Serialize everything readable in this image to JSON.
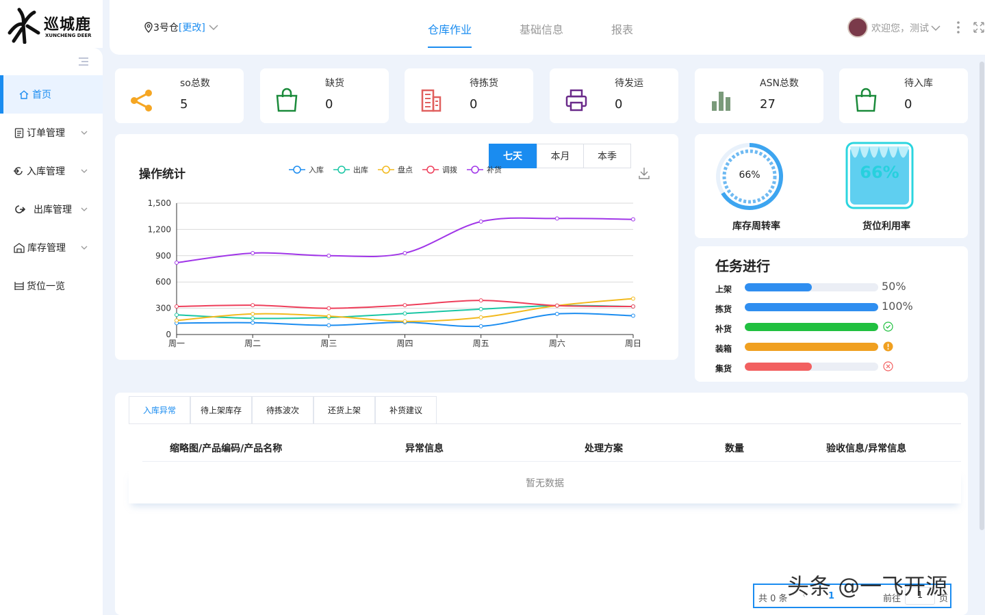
{
  "brand": {
    "name_cn": "巡城鹿",
    "name_en": "XUNCHENG DEER"
  },
  "header": {
    "warehouse": "3号仓",
    "change_label": "[更改]",
    "tabs": [
      "仓库作业",
      "基础信息",
      "报表"
    ],
    "active_tab": 0,
    "user_greeting": "欢迎您，测试"
  },
  "sidebar": {
    "items": [
      {
        "label": "首页",
        "icon": "home-icon",
        "active": true
      },
      {
        "label": "订单管理",
        "icon": "clipboard-icon"
      },
      {
        "label": "入库管理",
        "icon": "inbound-icon"
      },
      {
        "label": "出库管理",
        "icon": "outbound-icon"
      },
      {
        "label": "库存管理",
        "icon": "warehouse-icon"
      },
      {
        "label": "货位一览",
        "icon": "shelf-icon"
      }
    ]
  },
  "stats": [
    {
      "label": "so总数",
      "value": "5",
      "icon": "share-icon",
      "color": "#f5a623"
    },
    {
      "label": "缺货",
      "value": "0",
      "icon": "shopping-bag-icon",
      "color": "#1a8a3a"
    },
    {
      "label": "待拣货",
      "value": "0",
      "icon": "building-icon",
      "color": "#e0605f"
    },
    {
      "label": "待发运",
      "value": "0",
      "icon": "printer-icon",
      "color": "#6a2a8a"
    },
    {
      "label": "ASN总数",
      "value": "27",
      "icon": "bar-chart-icon",
      "color": "#7a9a7a"
    },
    {
      "label": "待入库",
      "value": "0",
      "icon": "shopping-bag-icon",
      "color": "#1a8a3a"
    }
  ],
  "op_chart": {
    "title": "操作统计",
    "ranges": [
      "七天",
      "本月",
      "本季"
    ],
    "active_range": 0
  },
  "chart_data": {
    "type": "line",
    "x": [
      "周一",
      "周二",
      "周三",
      "周四",
      "周五",
      "周六",
      "周日"
    ],
    "ylim": [
      0,
      1500
    ],
    "yticks": [
      "0",
      "300",
      "600",
      "900",
      "1,200",
      "1,500"
    ],
    "series": [
      {
        "name": "入库",
        "color": "#1a8cf0",
        "values": [
          130,
          135,
          105,
          140,
          95,
          235,
          215
        ]
      },
      {
        "name": "出库",
        "color": "#19c6a4",
        "values": [
          225,
          185,
          195,
          240,
          290,
          330,
          320
        ]
      },
      {
        "name": "盘点",
        "color": "#f2b91d",
        "values": [
          160,
          235,
          210,
          150,
          195,
          330,
          410
        ]
      },
      {
        "name": "调拨",
        "color": "#ee3e5a",
        "values": [
          320,
          335,
          300,
          335,
          390,
          330,
          320
        ]
      },
      {
        "name": "补货",
        "color": "#a035e8",
        "values": [
          820,
          930,
          900,
          930,
          1290,
          1325,
          1315
        ]
      }
    ],
    "grid": true,
    "legend": "top"
  },
  "gauges": [
    {
      "label": "库存周转率",
      "value": "66%"
    },
    {
      "label": "货位利用率",
      "value": "66%"
    }
  ],
  "tasks": {
    "title": "任务进行",
    "items": [
      {
        "label": "上架",
        "progress": 0.5,
        "text": "50%",
        "color": "#2f8ef0"
      },
      {
        "label": "拣货",
        "progress": 1.0,
        "text": "100%",
        "color": "#2f8ef0"
      },
      {
        "label": "补货",
        "progress": 1.0,
        "status_icon": "check-circle-icon",
        "color": "#20c040"
      },
      {
        "label": "装箱",
        "progress": 1.0,
        "status_icon": "warning-circle-icon",
        "color": "#f0a020"
      },
      {
        "label": "集货",
        "progress": 0.5,
        "status_icon": "close-circle-icon",
        "color": "#f26060"
      }
    ]
  },
  "bottom": {
    "tabs": [
      "入库异常",
      "待上架库存",
      "待拣波次",
      "还货上架",
      "补货建议"
    ],
    "active_tab": 0,
    "columns": [
      "缩略图/产品编码/产品名称",
      "异常信息",
      "处理方案",
      "数量",
      "验收信息/异常信息"
    ],
    "empty_text": "暂无数据"
  },
  "pagination": {
    "total": "共 0 条",
    "goto": "前往",
    "page": "1",
    "page_unit": "页"
  },
  "watermark": "头条 @一飞开源"
}
